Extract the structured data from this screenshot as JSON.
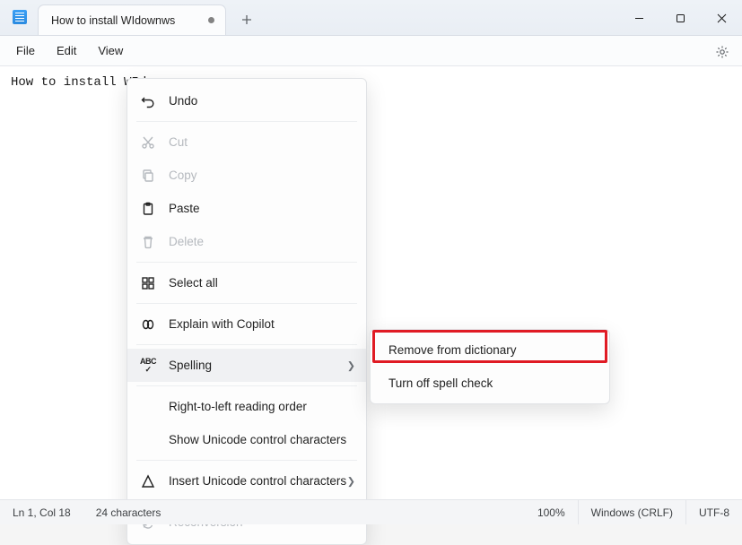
{
  "titlebar": {
    "tab_title": "How to install WIdownws"
  },
  "menubar": {
    "file": "File",
    "edit": "Edit",
    "view": "View"
  },
  "content": {
    "text": "How to install WId"
  },
  "context_menu": {
    "undo": "Undo",
    "cut": "Cut",
    "copy": "Copy",
    "paste": "Paste",
    "delete": "Delete",
    "select_all": "Select all",
    "explain_copilot": "Explain with Copilot",
    "spelling": "Spelling",
    "rtl_reading": "Right-to-left reading order",
    "show_unicode": "Show Unicode control characters",
    "insert_unicode": "Insert Unicode control characters",
    "reconversion": "Reconversion"
  },
  "submenu": {
    "remove_dictionary": "Remove from dictionary",
    "turn_off_spellcheck": "Turn off spell check"
  },
  "statusbar": {
    "position": "Ln 1, Col 18",
    "chars": "24 characters",
    "zoom": "100%",
    "line_ending": "Windows (CRLF)",
    "encoding": "UTF-8"
  }
}
